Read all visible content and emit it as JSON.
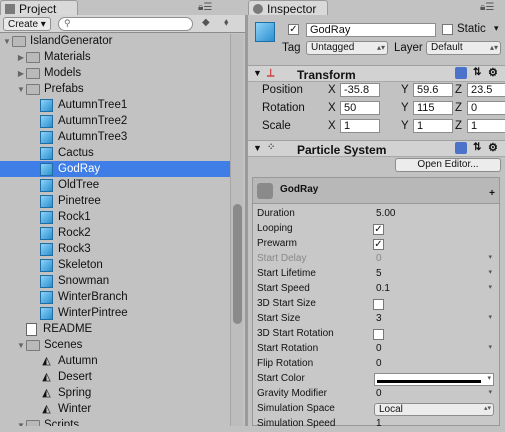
{
  "tabs": {
    "project": "Project",
    "inspector": "Inspector"
  },
  "project": {
    "create_label": "Create",
    "items": [
      {
        "label": "IslandGenerator",
        "kind": "folder",
        "expanded": true,
        "indent": 0
      },
      {
        "label": "Materials",
        "kind": "folder",
        "expanded": false,
        "indent": 1
      },
      {
        "label": "Models",
        "kind": "folder",
        "expanded": false,
        "indent": 1
      },
      {
        "label": "Prefabs",
        "kind": "folder",
        "expanded": true,
        "indent": 1
      },
      {
        "label": "AutumnTree1",
        "kind": "prefab",
        "indent": 2
      },
      {
        "label": "AutumnTree2",
        "kind": "prefab",
        "indent": 2
      },
      {
        "label": "AutumnTree3",
        "kind": "prefab",
        "indent": 2
      },
      {
        "label": "Cactus",
        "kind": "prefab",
        "indent": 2
      },
      {
        "label": "GodRay",
        "kind": "prefab",
        "indent": 2,
        "selected": true
      },
      {
        "label": "OldTree",
        "kind": "prefab",
        "indent": 2
      },
      {
        "label": "Pinetree",
        "kind": "prefab",
        "indent": 2
      },
      {
        "label": "Rock1",
        "kind": "prefab",
        "indent": 2
      },
      {
        "label": "Rock2",
        "kind": "prefab",
        "indent": 2
      },
      {
        "label": "Rock3",
        "kind": "prefab",
        "indent": 2
      },
      {
        "label": "Skeleton",
        "kind": "prefab",
        "indent": 2
      },
      {
        "label": "Snowman",
        "kind": "prefab",
        "indent": 2
      },
      {
        "label": "WinterBranch",
        "kind": "prefab",
        "indent": 2
      },
      {
        "label": "WinterPintree",
        "kind": "prefab",
        "indent": 2
      },
      {
        "label": "README",
        "kind": "doc",
        "indent": 1
      },
      {
        "label": "Scenes",
        "kind": "folder",
        "expanded": true,
        "indent": 1
      },
      {
        "label": "Autumn",
        "kind": "scene",
        "indent": 2
      },
      {
        "label": "Desert",
        "kind": "scene",
        "indent": 2
      },
      {
        "label": "Spring",
        "kind": "scene",
        "indent": 2
      },
      {
        "label": "Winter",
        "kind": "scene",
        "indent": 2
      },
      {
        "label": "Scripts",
        "kind": "folder",
        "expanded": true,
        "indent": 1
      }
    ]
  },
  "inspector": {
    "object_name": "GodRay",
    "static_label": "Static",
    "tag_label": "Tag",
    "tag_value": "Untagged",
    "layer_label": "Layer",
    "layer_value": "Default",
    "transform": {
      "title": "Transform",
      "position_label": "Position",
      "position": {
        "x": "-35.8",
        "y": "59.6",
        "z": "23.5"
      },
      "rotation_label": "Rotation",
      "rotation": {
        "x": "50",
        "y": "115",
        "z": "0"
      },
      "scale_label": "Scale",
      "scale": {
        "x": "1",
        "y": "1",
        "z": "1"
      },
      "axis": {
        "x": "X",
        "y": "Y",
        "z": "Z"
      }
    },
    "particle": {
      "title": "Particle System",
      "open_editor": "Open Editor...",
      "module_name": "GodRay",
      "props": [
        {
          "name": "Duration",
          "value": "5.00",
          "type": "field"
        },
        {
          "name": "Looping",
          "value": "✓",
          "type": "check"
        },
        {
          "name": "Prewarm",
          "value": "✓",
          "type": "check"
        },
        {
          "name": "Start Delay",
          "value": "0",
          "type": "field",
          "disabled": true
        },
        {
          "name": "Start Lifetime",
          "value": "5",
          "type": "dd"
        },
        {
          "name": "Start Speed",
          "value": "0.1",
          "type": "dd"
        },
        {
          "name": "3D Start Size",
          "value": "",
          "type": "check"
        },
        {
          "name": "Start Size",
          "value": "3",
          "type": "dd"
        },
        {
          "name": "3D Start Rotation",
          "value": "",
          "type": "check"
        },
        {
          "name": "Start Rotation",
          "value": "0",
          "type": "dd"
        },
        {
          "name": "Flip Rotation",
          "value": "0",
          "type": "field"
        },
        {
          "name": "Start Color",
          "value": "",
          "type": "color"
        },
        {
          "name": "Gravity Modifier",
          "value": "0",
          "type": "dd"
        },
        {
          "name": "Simulation Space",
          "value": "Local",
          "type": "select"
        },
        {
          "name": "Simulation Speed",
          "value": "1",
          "type": "field"
        }
      ]
    }
  }
}
